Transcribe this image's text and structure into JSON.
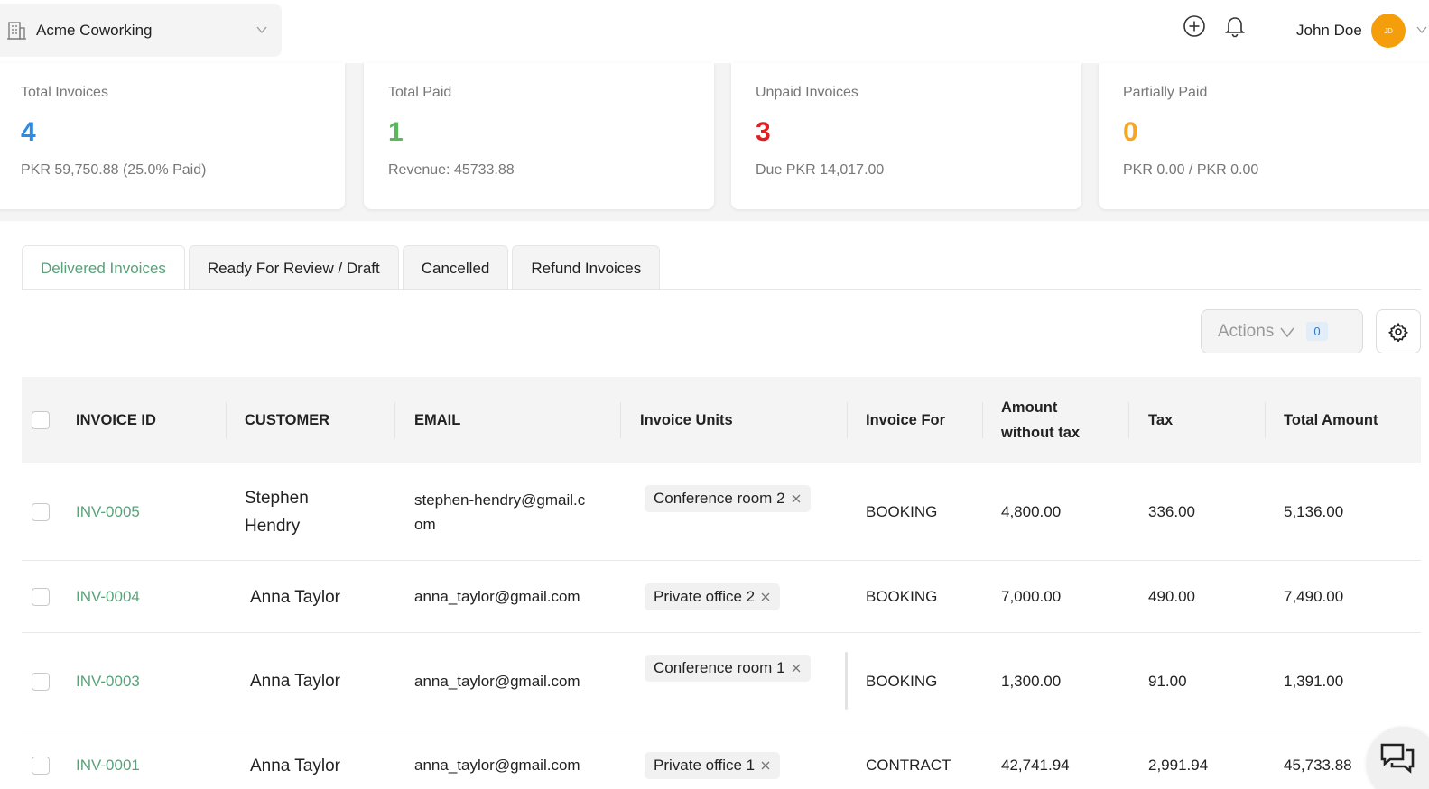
{
  "header": {
    "workspace_name": "Acme Coworking",
    "user_name": "John Doe",
    "avatar_initials": "JD",
    "accent_avatar_color": "#f59e0b"
  },
  "stats": [
    {
      "label": "Total Invoices",
      "value": "4",
      "sub": "PKR 59,750.88 (25.0% Paid)",
      "color": "#2b8be6"
    },
    {
      "label": "Total Paid",
      "value": "1",
      "sub": "Revenue: 45733.88",
      "color": "#5cb85c"
    },
    {
      "label": "Unpaid Invoices",
      "value": "3",
      "sub": "Due PKR 14,017.00",
      "color": "#e02020"
    },
    {
      "label": "Partially Paid",
      "value": "0",
      "sub": "PKR 0.00 / PKR 0.00",
      "color": "#f5a623"
    }
  ],
  "tabs": [
    "Delivered Invoices",
    "Ready For Review / Draft",
    "Cancelled",
    "Refund Invoices"
  ],
  "toolbar": {
    "actions_label": "Actions",
    "selected_count": "0"
  },
  "table": {
    "columns": [
      "INVOICE ID",
      "CUSTOMER",
      "EMAIL",
      "Invoice Units",
      "Invoice For",
      "Amount without tax",
      "Tax",
      "Total Amount"
    ],
    "rows": [
      {
        "id": "INV-0005",
        "customer": "Stephen Hendry",
        "email": "stephen-hendry@gmail.com",
        "unit": "Conference room 2",
        "for": "BOOKING",
        "amount": "4,800.00",
        "tax": "336.00",
        "total": "5,136.00"
      },
      {
        "id": "INV-0004",
        "customer": "Anna Taylor",
        "email": "anna_taylor@gmail.com",
        "unit": "Private office 2",
        "for": "BOOKING",
        "amount": "7,000.00",
        "tax": "490.00",
        "total": "7,490.00"
      },
      {
        "id": "INV-0003",
        "customer": "Anna Taylor",
        "email": "anna_taylor@gmail.com",
        "unit": "Conference room 1",
        "for": "BOOKING",
        "amount": "1,300.00",
        "tax": "91.00",
        "total": "1,391.00"
      },
      {
        "id": "INV-0001",
        "customer": "Anna Taylor",
        "email": "anna_taylor@gmail.com",
        "unit": "Private office 1",
        "for": "CONTRACT",
        "amount": "42,741.94",
        "tax": "2,991.94",
        "total": "45,733.88"
      }
    ]
  },
  "colors": {
    "brand_green": "#5aa17a",
    "panel_gray": "#f4f4f4"
  }
}
